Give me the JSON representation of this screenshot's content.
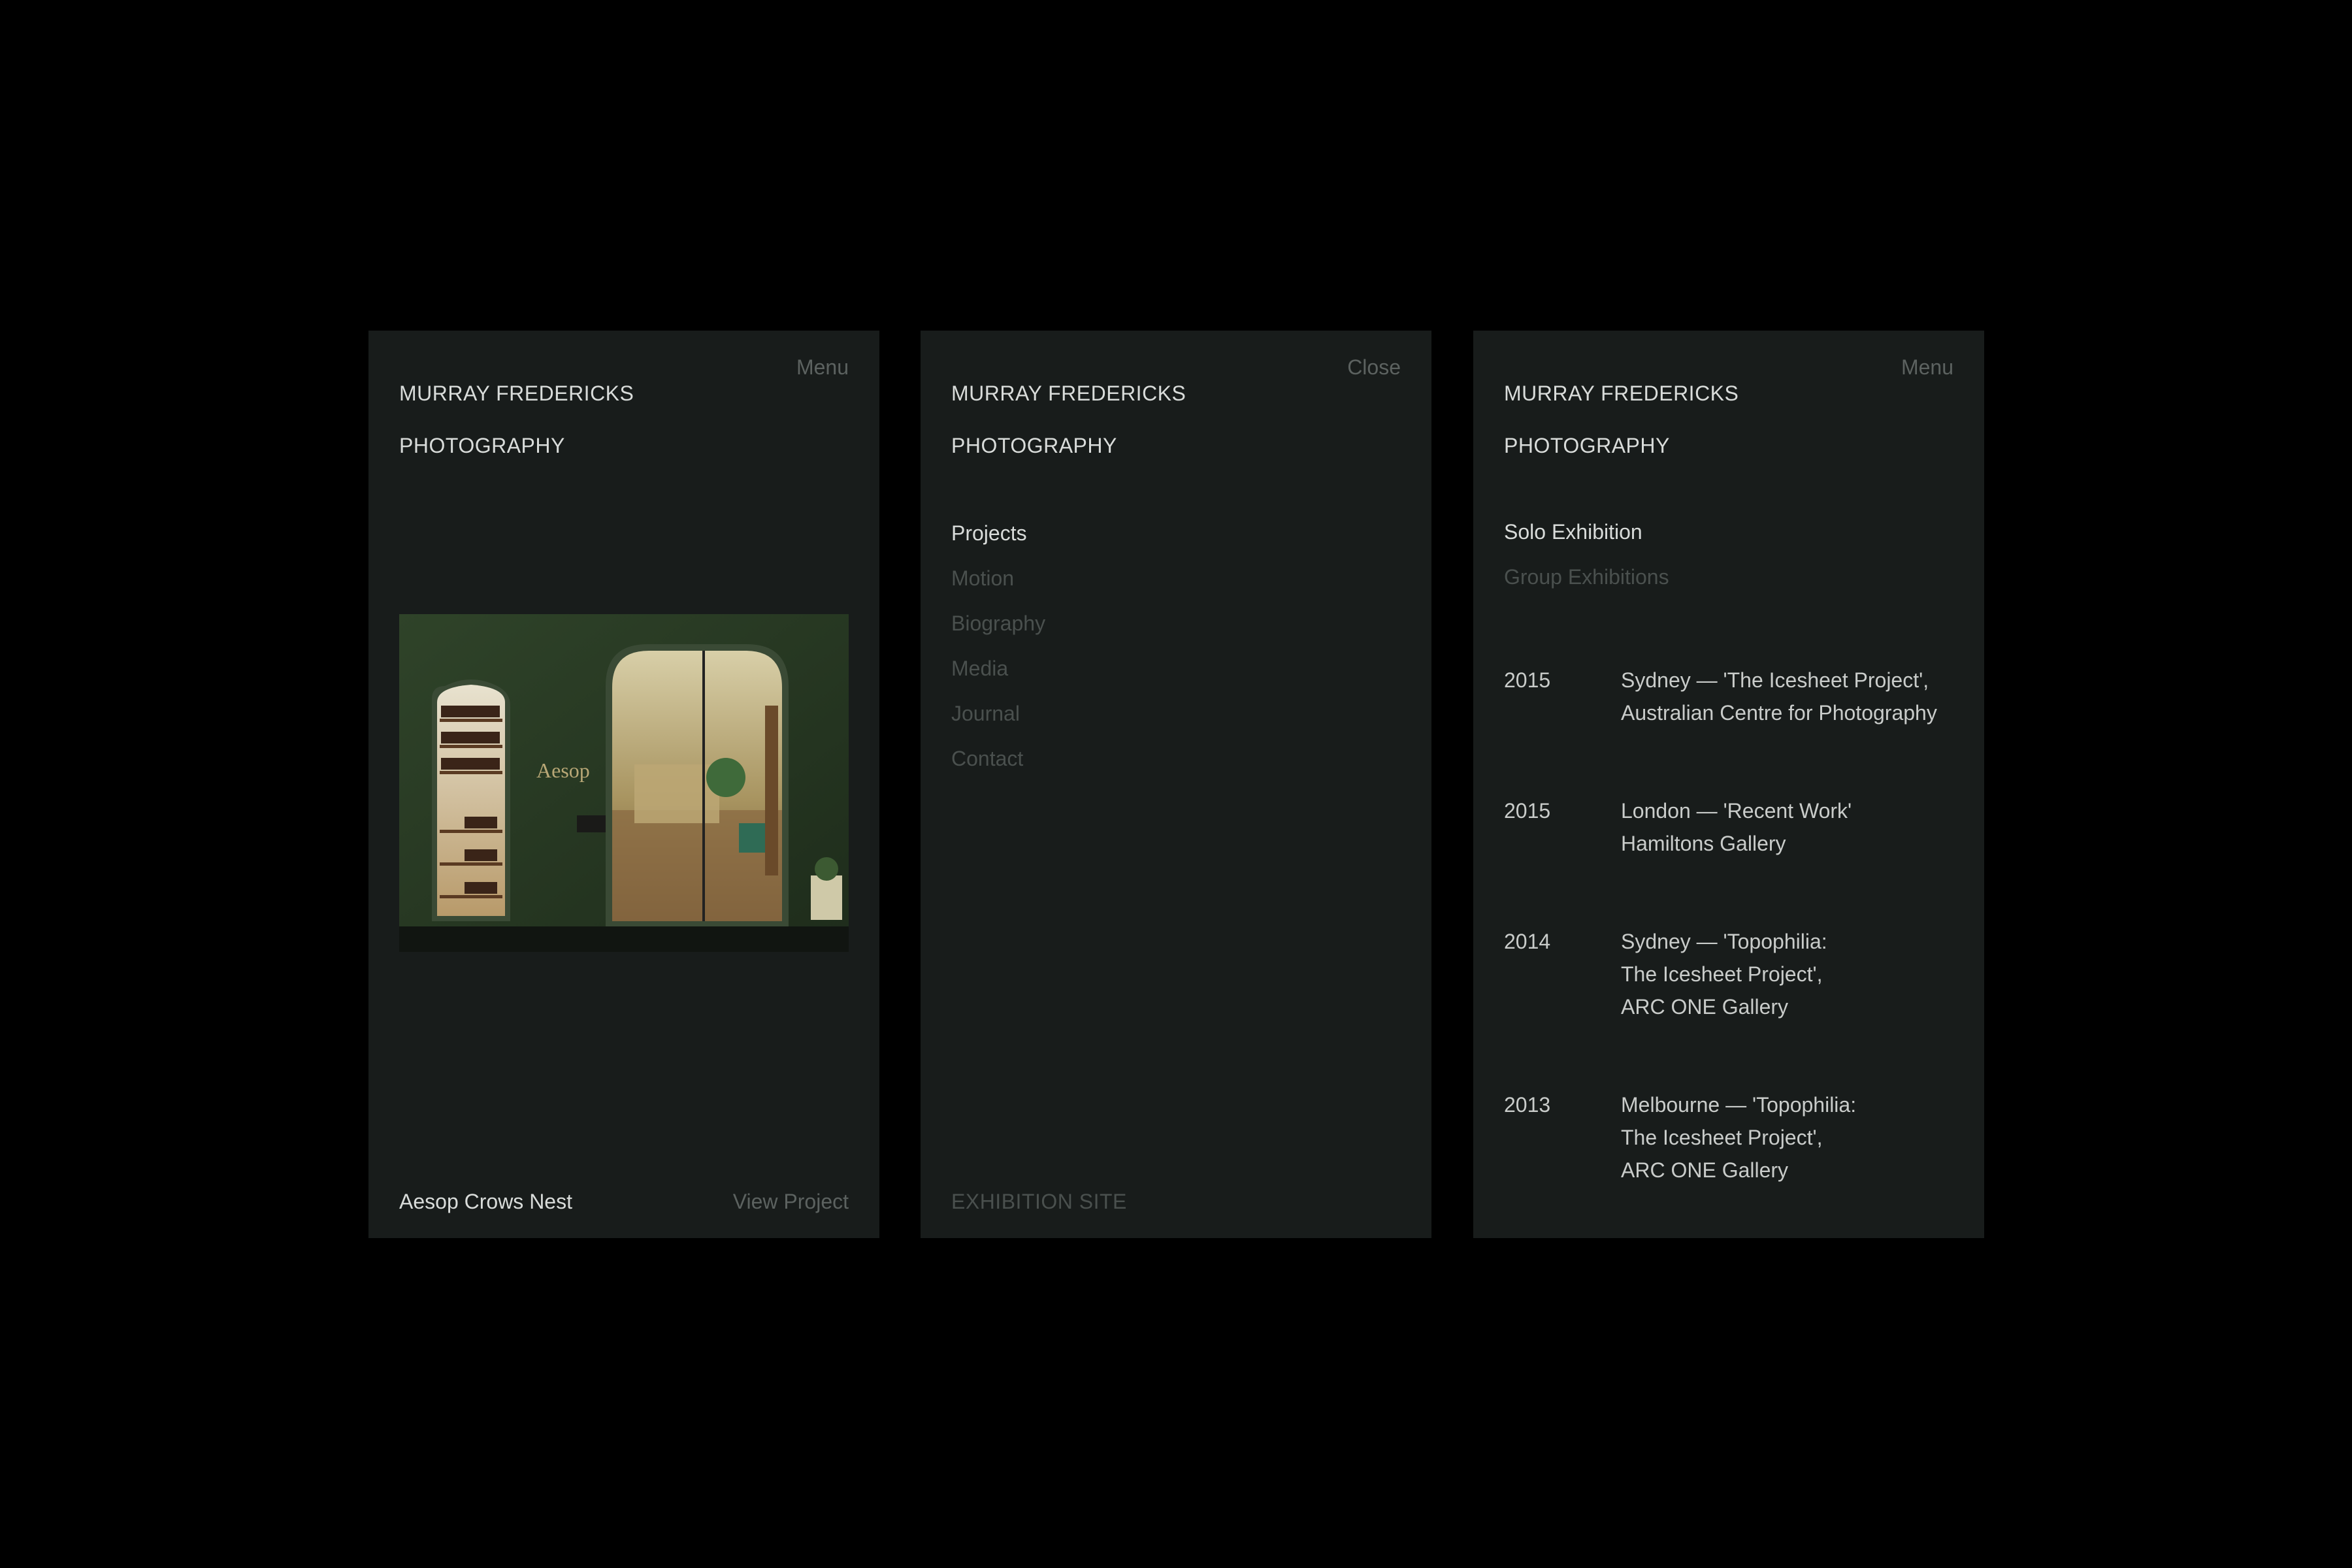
{
  "brand": {
    "line1": "MURRAY FREDERICKS",
    "line2": "PHOTOGRAPHY"
  },
  "panel1": {
    "top_action": "Menu",
    "hero_sign": "Aesop",
    "project_name": "Aesop Crows Nest",
    "view_project": "View Project"
  },
  "panel2": {
    "top_action": "Close",
    "menu": [
      {
        "label": "Projects",
        "active": true
      },
      {
        "label": "Motion",
        "active": false
      },
      {
        "label": "Biography",
        "active": false
      },
      {
        "label": "Media",
        "active": false
      },
      {
        "label": "Journal",
        "active": false
      },
      {
        "label": "Contact",
        "active": false
      }
    ],
    "exhibition_site": "EXHIBITION SITE"
  },
  "panel3": {
    "top_action": "Menu",
    "tabs": [
      {
        "label": "Solo Exhibition",
        "active": true
      },
      {
        "label": "Group Exhibitions",
        "active": false
      }
    ],
    "exhibitions": [
      {
        "year": "2015",
        "lines": [
          "Sydney — 'The Icesheet Project',",
          "Australian Centre for Photography"
        ]
      },
      {
        "year": "2015",
        "lines": [
          "London — 'Recent Work'",
          "Hamiltons Gallery"
        ]
      },
      {
        "year": "2014",
        "lines": [
          "Sydney — 'Topophilia:",
          "The Icesheet Project',",
          "ARC ONE Gallery"
        ]
      },
      {
        "year": "2013",
        "lines": [
          "Melbourne — 'Topophilia:",
          "The Icesheet Project',",
          "ARC ONE Gallery"
        ]
      }
    ]
  },
  "colors": {
    "background": "#000000",
    "panel": "#181c1b",
    "text_primary": "#d9dcda",
    "text_muted": "#4a504e",
    "storefront_green": "#2b3d26"
  }
}
